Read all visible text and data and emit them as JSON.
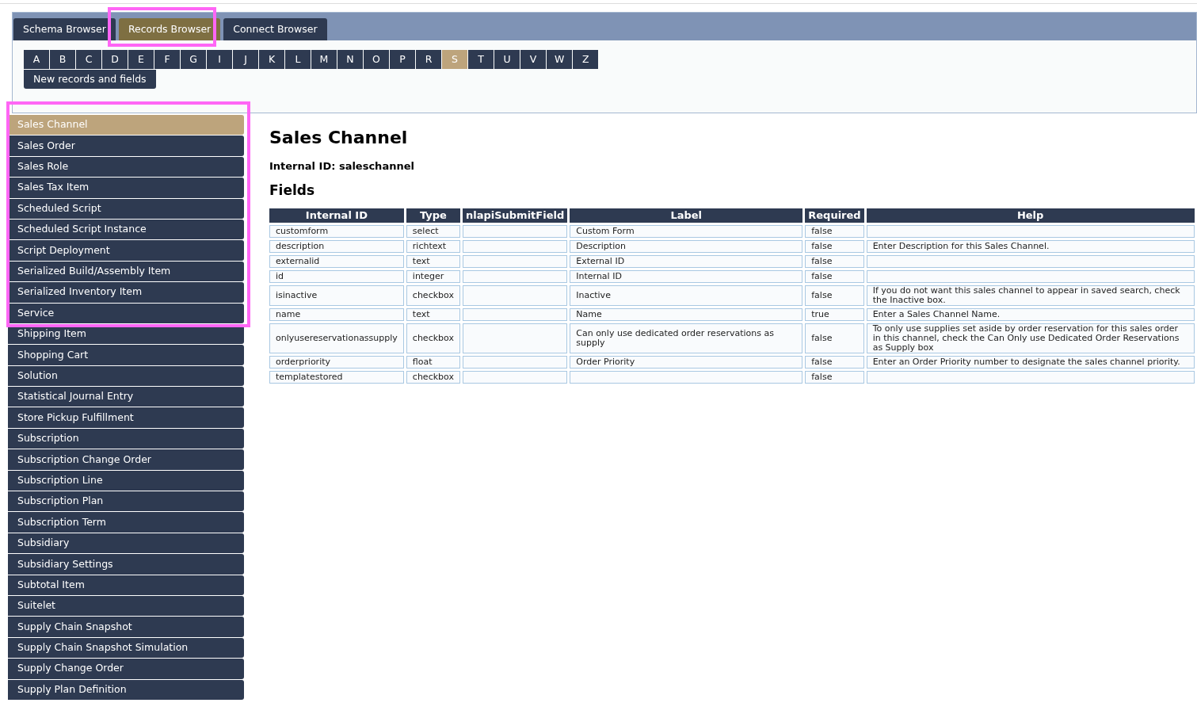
{
  "tabs": [
    {
      "label": "Schema Browser",
      "selected": false
    },
    {
      "label": "Records Browser",
      "selected": true
    },
    {
      "label": "Connect Browser",
      "selected": false
    }
  ],
  "letters": [
    {
      "label": "A",
      "selected": false
    },
    {
      "label": "B",
      "selected": false
    },
    {
      "label": "C",
      "selected": false
    },
    {
      "label": "D",
      "selected": false
    },
    {
      "label": "E",
      "selected": false
    },
    {
      "label": "F",
      "selected": false
    },
    {
      "label": "G",
      "selected": false
    },
    {
      "label": "I",
      "selected": false
    },
    {
      "label": "J",
      "selected": false
    },
    {
      "label": "K",
      "selected": false
    },
    {
      "label": "L",
      "selected": false
    },
    {
      "label": "M",
      "selected": false
    },
    {
      "label": "N",
      "selected": false
    },
    {
      "label": "O",
      "selected": false
    },
    {
      "label": "P",
      "selected": false
    },
    {
      "label": "R",
      "selected": false
    },
    {
      "label": "S",
      "selected": true
    },
    {
      "label": "T",
      "selected": false
    },
    {
      "label": "U",
      "selected": false
    },
    {
      "label": "V",
      "selected": false
    },
    {
      "label": "W",
      "selected": false
    },
    {
      "label": "Z",
      "selected": false
    }
  ],
  "new_records_button": "New records and fields",
  "sidebar": {
    "items": [
      {
        "label": "Sales Channel",
        "selected": true
      },
      {
        "label": "Sales Order",
        "selected": false
      },
      {
        "label": "Sales Role",
        "selected": false
      },
      {
        "label": "Sales Tax Item",
        "selected": false
      },
      {
        "label": "Scheduled Script",
        "selected": false
      },
      {
        "label": "Scheduled Script Instance",
        "selected": false
      },
      {
        "label": "Script Deployment",
        "selected": false
      },
      {
        "label": "Serialized Build/Assembly Item",
        "selected": false
      },
      {
        "label": "Serialized Inventory Item",
        "selected": false
      },
      {
        "label": "Service",
        "selected": false
      },
      {
        "label": "Shipping Item",
        "selected": false
      },
      {
        "label": "Shopping Cart",
        "selected": false
      },
      {
        "label": "Solution",
        "selected": false
      },
      {
        "label": "Statistical Journal Entry",
        "selected": false
      },
      {
        "label": "Store Pickup Fulfillment",
        "selected": false
      },
      {
        "label": "Subscription",
        "selected": false
      },
      {
        "label": "Subscription Change Order",
        "selected": false
      },
      {
        "label": "Subscription Line",
        "selected": false
      },
      {
        "label": "Subscription Plan",
        "selected": false
      },
      {
        "label": "Subscription Term",
        "selected": false
      },
      {
        "label": "Subsidiary",
        "selected": false
      },
      {
        "label": "Subsidiary Settings",
        "selected": false
      },
      {
        "label": "Subtotal Item",
        "selected": false
      },
      {
        "label": "Suitelet",
        "selected": false
      },
      {
        "label": "Supply Chain Snapshot",
        "selected": false
      },
      {
        "label": "Supply Chain Snapshot Simulation",
        "selected": false
      },
      {
        "label": "Supply Change Order",
        "selected": false
      },
      {
        "label": "Supply Plan Definition",
        "selected": false
      }
    ]
  },
  "record": {
    "title": "Sales Channel",
    "internal_id": "Internal ID: saleschannel",
    "fields_heading": "Fields"
  },
  "table": {
    "columns": [
      "Internal ID",
      "Type",
      "nlapiSubmitField",
      "Label",
      "Required",
      "Help"
    ],
    "rows": [
      [
        "customform",
        "select",
        "",
        "Custom Form",
        "false",
        ""
      ],
      [
        "description",
        "richtext",
        "",
        "Description",
        "false",
        "Enter Description for this Sales Channel."
      ],
      [
        "externalid",
        "text",
        "",
        "External ID",
        "false",
        ""
      ],
      [
        "id",
        "integer",
        "",
        "Internal ID",
        "false",
        ""
      ],
      [
        "isinactive",
        "checkbox",
        "",
        "Inactive",
        "false",
        "If you do not want this sales channel to appear in saved search, check the Inactive box."
      ],
      [
        "name",
        "text",
        "",
        "Name",
        "true",
        "Enter a Sales Channel Name."
      ],
      [
        "onlyusereservationassupply",
        "checkbox",
        "",
        "Can only use dedicated order reservations as supply",
        "false",
        "To only use supplies set aside by order reservation for this sales order in this channel, check the Can Only use Dedicated Order Reservations as Supply box"
      ],
      [
        "orderpriority",
        "float",
        "",
        "Order Priority",
        "false",
        "Enter an Order Priority number to designate the sales channel priority."
      ],
      [
        "templatestored",
        "checkbox",
        "",
        "",
        "false",
        ""
      ]
    ]
  }
}
